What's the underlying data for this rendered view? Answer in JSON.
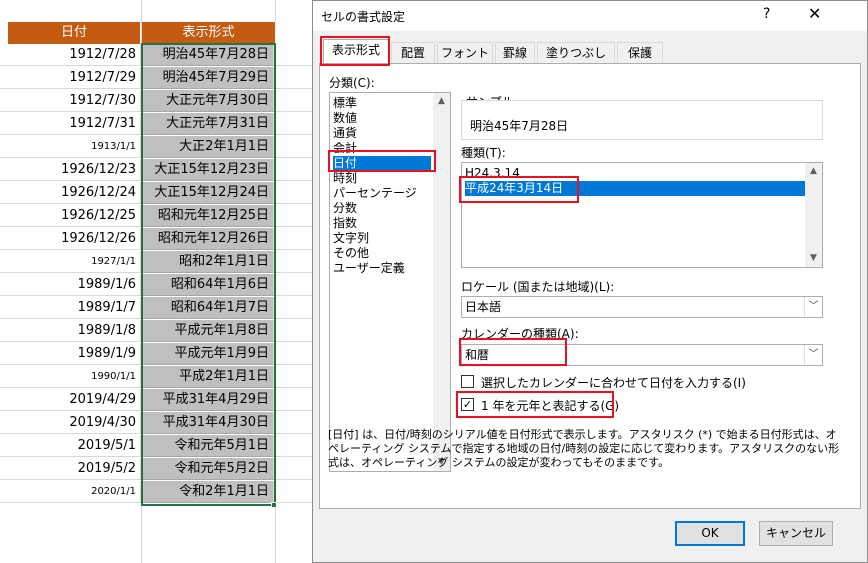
{
  "sheet": {
    "col_a_header": "日付",
    "col_b_header": "表示形式",
    "rows": [
      {
        "a": "1912/7/28",
        "b": "明治45年7月28日"
      },
      {
        "a": "1912/7/29",
        "b": "明治45年7月29日"
      },
      {
        "a": "1912/7/30",
        "b": "大正元年7月30日"
      },
      {
        "a": "1912/7/31",
        "b": "大正元年7月31日"
      },
      {
        "a": "1913/1/1",
        "b": "大正2年1月1日"
      },
      {
        "a": "1926/12/23",
        "b": "大正15年12月23日"
      },
      {
        "a": "1926/12/24",
        "b": "大正15年12月24日"
      },
      {
        "a": "1926/12/25",
        "b": "昭和元年12月25日"
      },
      {
        "a": "1926/12/26",
        "b": "昭和元年12月26日"
      },
      {
        "a": "1927/1/1",
        "b": "昭和2年1月1日"
      },
      {
        "a": "1989/1/6",
        "b": "昭和64年1月6日"
      },
      {
        "a": "1989/1/7",
        "b": "昭和64年1月7日"
      },
      {
        "a": "1989/1/8",
        "b": "平成元年1月8日"
      },
      {
        "a": "1989/1/9",
        "b": "平成元年1月9日"
      },
      {
        "a": "1990/1/1",
        "b": "平成2年1月1日"
      },
      {
        "a": "2019/4/29",
        "b": "平成31年4月29日"
      },
      {
        "a": "2019/4/30",
        "b": "平成31年4月30日"
      },
      {
        "a": "2019/5/1",
        "b": "令和元年5月1日"
      },
      {
        "a": "2019/5/2",
        "b": "令和元年5月2日"
      },
      {
        "a": "2020/1/1",
        "b": "令和2年1月1日"
      }
    ]
  },
  "dialog": {
    "title": "セルの書式設定",
    "help": "?",
    "close": "✕",
    "tabs": [
      "表示形式",
      "配置",
      "フォント",
      "罫線",
      "塗りつぶし",
      "保護"
    ],
    "category_label": "分類(C):",
    "categories": [
      "標準",
      "数値",
      "通貨",
      "会計",
      "日付",
      "時刻",
      "パーセンテージ",
      "分数",
      "指数",
      "文字列",
      "その他",
      "ユーザー定義"
    ],
    "selected_category": "日付",
    "sample_label": "サンプル",
    "sample_value": "明治45年7月28日",
    "type_label": "種類(T):",
    "types": [
      "H24.3.14",
      "平成24年3月14日"
    ],
    "selected_type": "平成24年3月14日",
    "locale_label": "ロケール (国または地域)(L):",
    "locale_value": "日本語",
    "calendar_label": "カレンダーの種類(A):",
    "calendar_value": "和暦",
    "check1_label": "選択したカレンダーに合わせて日付を入力する(I)",
    "check1_checked": false,
    "check2_label": "1 年を元年と表記する(G)",
    "check2_checked": true,
    "description": "[日付] は、日付/時刻のシリアル値を日付形式で表示します。アスタリスク (*) で始まる日付形式は、オペレーティング システムで指定する地域の日付/時刻の設定に応じて変わります。アスタリスクのない形式は、オペレーティング システムの設定が変わってもそのままです。",
    "ok": "OK",
    "cancel": "キャンセル"
  },
  "colors": {
    "header_bg": "#c55a11",
    "selection_border": "#217346",
    "highlight": "#0078d7",
    "annotation": "#e81123"
  }
}
